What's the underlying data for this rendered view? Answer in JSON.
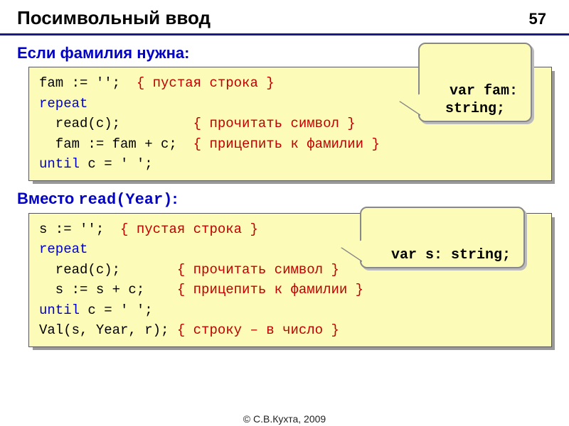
{
  "page": {
    "title": "Посимвольный ввод",
    "number": "57",
    "footer": "© С.В.Кухта, 2009"
  },
  "section1": {
    "label": "Если фамилия нужна:",
    "callout": "var fam:\nstring;",
    "code": {
      "l1a": "fam := '';  ",
      "l1b": "{ пустая строка }",
      "l2": "repeat",
      "l3a": "  read(c);         ",
      "l3b": "{ прочитать символ }",
      "l4a": "  fam := fam + c;  ",
      "l4b": "{ прицепить к фамилии }",
      "l5a": "until",
      "l5b": " c = ' ';"
    }
  },
  "section2": {
    "label_a": "Вместо ",
    "label_b": "read(Year)",
    "label_c": ":",
    "callout": "var s: string;",
    "code": {
      "l1a": "s := '';  ",
      "l1b": "{ пустая строка }",
      "l2": "repeat",
      "l3a": "  read(c);       ",
      "l3b": "{ прочитать символ }",
      "l4a": "  s := s + c;    ",
      "l4b": "{ прицепить к фамилии }",
      "l5a": "until",
      "l5b": " c = ' ';",
      "l6a": "Val(s, Year, r); ",
      "l6b": "{ строку – в число }"
    }
  }
}
